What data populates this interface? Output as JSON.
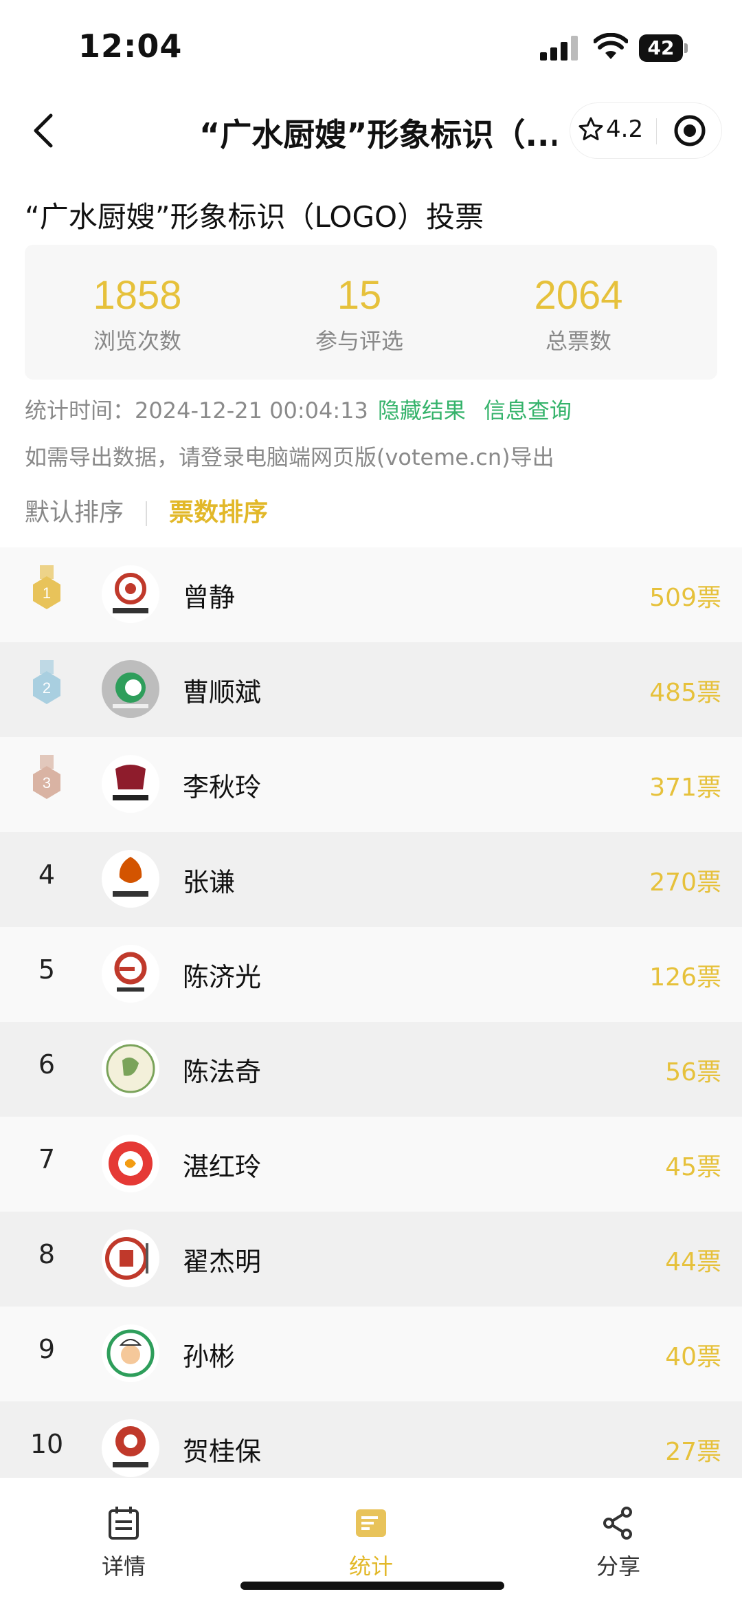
{
  "status": {
    "time": "12:04",
    "battery": "42"
  },
  "nav": {
    "title": "“广水厨嫂”形象标识（...",
    "rating": "4.2"
  },
  "page": {
    "title": "“广水厨嫂”形象标识（LOGO）投票"
  },
  "stats": [
    {
      "value": "1858",
      "label": "浏览次数"
    },
    {
      "value": "15",
      "label": "参与评选"
    },
    {
      "value": "2064",
      "label": "总票数"
    }
  ],
  "meta": {
    "time_label": "统计时间：2024-12-21 00:04:13",
    "hide_results": "隐藏结果",
    "info_query": "信息查询",
    "export_note": "如需导出数据，请登录电脑端网页版(voteme.cn)导出"
  },
  "sort": {
    "default": "默认排序",
    "by_votes": "票数排序"
  },
  "entries": [
    {
      "rank": "1",
      "name": "曾静",
      "votes": "509票",
      "medal": "gold"
    },
    {
      "rank": "2",
      "name": "曹顺斌",
      "votes": "485票",
      "medal": "silver"
    },
    {
      "rank": "3",
      "name": "李秋玲",
      "votes": "371票",
      "medal": "bronze"
    },
    {
      "rank": "4",
      "name": "张谦",
      "votes": "270票"
    },
    {
      "rank": "5",
      "name": "陈济光",
      "votes": "126票"
    },
    {
      "rank": "6",
      "name": "陈法奇",
      "votes": "56票"
    },
    {
      "rank": "7",
      "name": "湛红玲",
      "votes": "45票"
    },
    {
      "rank": "8",
      "name": "翟杰明",
      "votes": "44票"
    },
    {
      "rank": "9",
      "name": "孙彬",
      "votes": "40票"
    },
    {
      "rank": "10",
      "name": "贺桂保",
      "votes": "27票"
    }
  ],
  "tabs": [
    {
      "label": "详情",
      "icon": "calendar-icon"
    },
    {
      "label": "统计",
      "icon": "stats-icon"
    },
    {
      "label": "分享",
      "icon": "share-icon"
    }
  ],
  "colors": {
    "accent": "#e6c13b",
    "link": "#35b36b",
    "gold": "#e8c35a",
    "silver": "#a9cfe0",
    "bronze": "#d9b3a3"
  }
}
